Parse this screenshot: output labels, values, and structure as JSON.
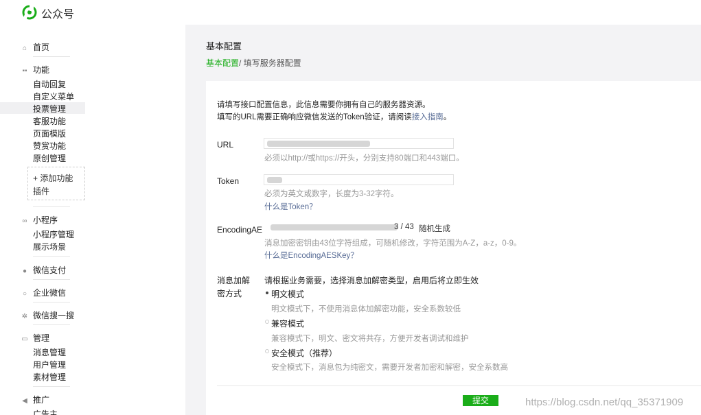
{
  "header": {
    "brand": "公众号",
    "logo_icon": "wechat-public-logo-icon"
  },
  "sidebar": {
    "home": "首页",
    "features": {
      "title": "功能",
      "items": [
        "自动回复",
        "自定义菜单",
        "投票管理",
        "客服功能",
        "页面模版",
        "赞赏功能",
        "原创管理"
      ]
    },
    "add_feature": {
      "line1": "+ 添加功能",
      "line2": "插件"
    },
    "miniprogram": {
      "title": "小程序",
      "items": [
        "小程序管理",
        "展示场景"
      ]
    },
    "pay": "微信支付",
    "work": "企业微信",
    "search": "微信搜一搜",
    "manage": {
      "title": "管理",
      "items": [
        "消息管理",
        "用户管理",
        "素材管理"
      ]
    },
    "promote": {
      "title": "推广",
      "items": [
        "广告主"
      ]
    },
    "active_item": "投票管理"
  },
  "main": {
    "title": "基本配置",
    "breadcrumb": {
      "link": "基本配置",
      "sep": "/ ",
      "current": "填写服务器配置"
    },
    "intro": {
      "line1": "请填写接口配置信息，此信息需要你拥有自己的服务器资源。",
      "line2_prefix": "填写的URL需要正确响应微信发送的Token验证，请阅读",
      "line2_link": "接入指南",
      "line2_suffix": "。"
    },
    "fields": {
      "url": {
        "label": "URL",
        "hint": "必须以http://或https://开头，分别支持80端口和443端口。"
      },
      "token": {
        "label": "Token",
        "hint": "必须为英文或数字，长度为3-32字符。",
        "link": "什么是Token？"
      },
      "aeskey": {
        "label": "EncodingAE",
        "counter": "3 / 43",
        "generate": "随机生成",
        "hint": "消息加密密钥由43位字符组成，可随机修改，字符范围为A-Z，a-z，0-9。",
        "link": "什么是EncodingAESKey？"
      },
      "encrypt": {
        "label_line1": "消息加解",
        "label_line2": "密方式",
        "desc": "请根据业务需要，选择消息加解密类型，启用后将立即生效",
        "options": [
          {
            "label": "明文模式",
            "hint": "明文模式下，不使用消息体加解密功能，安全系数较低",
            "selected": true
          },
          {
            "label": "兼容模式",
            "hint": "兼容模式下，明文、密文将共存，方便开发者调试和维护",
            "selected": false
          },
          {
            "label": "安全模式（推荐）",
            "hint": "安全模式下，消息包为纯密文，需要开发者加密和解密，安全系数高",
            "selected": false
          }
        ]
      }
    },
    "submit": "提交"
  },
  "watermark": "https://blog.csdn.net/qq_35371909",
  "colors": {
    "brand_green": "#1aad19",
    "link_blue": "#576b95"
  }
}
